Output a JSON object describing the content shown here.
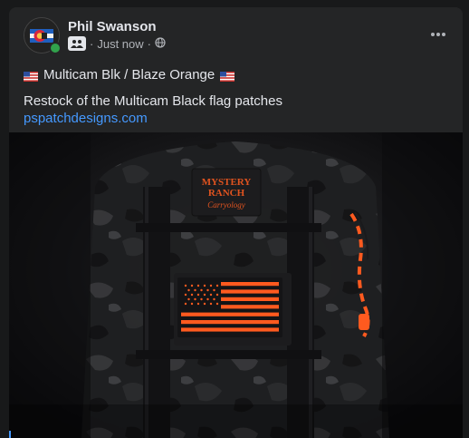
{
  "post": {
    "author": "Phil Swanson",
    "timestamp": "Just now",
    "separator": "·",
    "headline": "Multicam Blk / Blaze Orange",
    "body": "Restock of the Multicam Black flag patches",
    "link": "pspatchdesigns.com"
  },
  "image": {
    "brand_line1": "MYSTERY",
    "brand_line2": "RANCH",
    "brand_line3": "Carryology"
  },
  "icons": {
    "avatar": "colorado-flag-avatar",
    "group": "group-icon",
    "privacy": "globe-icon",
    "more": "more-options-icon",
    "flag": "us-flag-emoji"
  },
  "colors": {
    "background": "#18191a",
    "card": "#242526",
    "text": "#e4e6eb",
    "secondary": "#b0b3b8",
    "link": "#4599ff",
    "online": "#31a24c",
    "blaze_orange": "#ff5a1f"
  }
}
